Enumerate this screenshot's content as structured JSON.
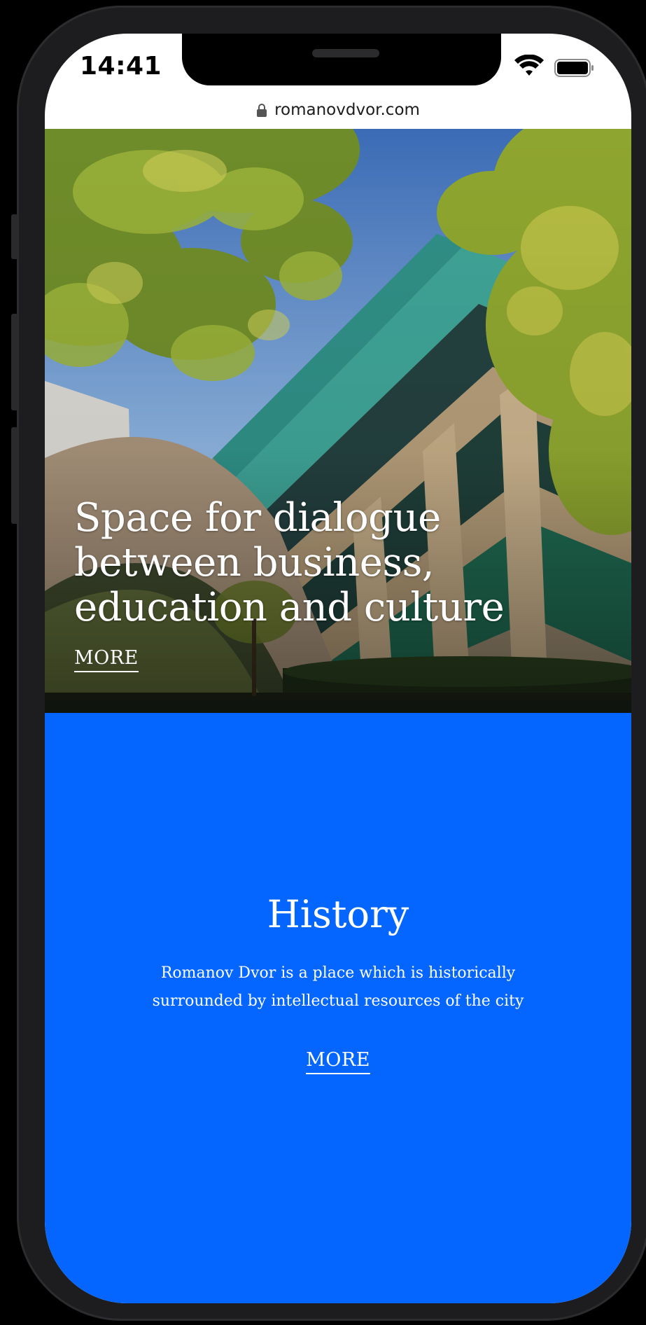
{
  "status_bar": {
    "time": "14:41",
    "icons": [
      "wifi-icon",
      "battery-icon"
    ]
  },
  "browser": {
    "url": "romanovdvor.com",
    "lock_icon": "lock-icon"
  },
  "hero": {
    "title": "Space for dialogue between business, education and culture",
    "more_label": "MORE"
  },
  "history": {
    "title": "History",
    "description": "Romanov Dvor is a place which is historically surrounded by intellectual resources of the city",
    "more_label": "MORE"
  },
  "colors": {
    "accent_blue": "#0466fe",
    "text_white": "#ffffff",
    "device_frame": "#1d1d1f"
  }
}
